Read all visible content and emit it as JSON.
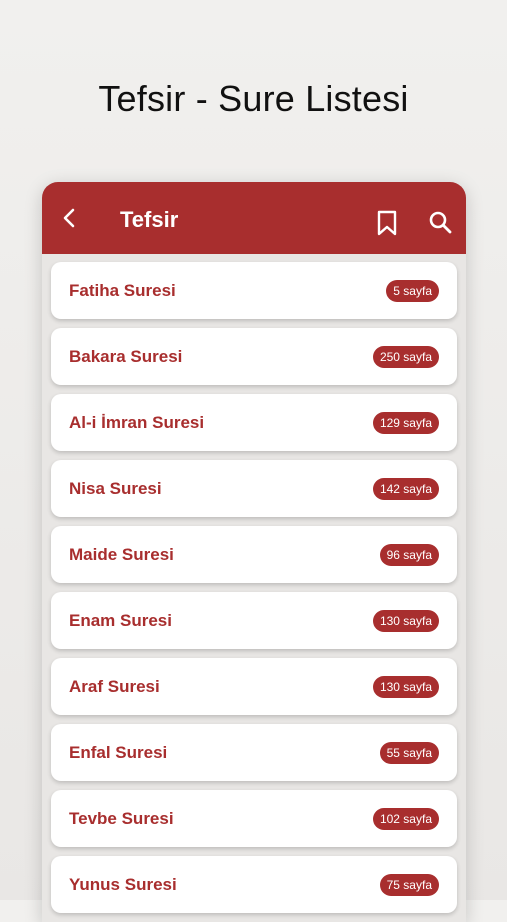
{
  "page": {
    "title": "Tefsir - Sure Listesi"
  },
  "appbar": {
    "title": "Tefsir"
  },
  "colors": {
    "primary": "#a82e2e",
    "card": "#ffffff"
  },
  "icons": {
    "back": "chevron-left-icon",
    "bookmark": "bookmark-icon",
    "search": "search-icon"
  },
  "surahs": [
    {
      "name": "Fatiha Suresi",
      "pages": "5 sayfa"
    },
    {
      "name": "Bakara Suresi",
      "pages": "250 sayfa"
    },
    {
      "name": "Al-i İmran Suresi",
      "pages": "129 sayfa"
    },
    {
      "name": "Nisa Suresi",
      "pages": "142 sayfa"
    },
    {
      "name": "Maide Suresi",
      "pages": "96 sayfa"
    },
    {
      "name": "Enam Suresi",
      "pages": "130 sayfa"
    },
    {
      "name": "Araf Suresi",
      "pages": "130 sayfa"
    },
    {
      "name": "Enfal Suresi",
      "pages": "55 sayfa"
    },
    {
      "name": "Tevbe Suresi",
      "pages": "102 sayfa"
    },
    {
      "name": "Yunus Suresi",
      "pages": "75 sayfa"
    }
  ]
}
